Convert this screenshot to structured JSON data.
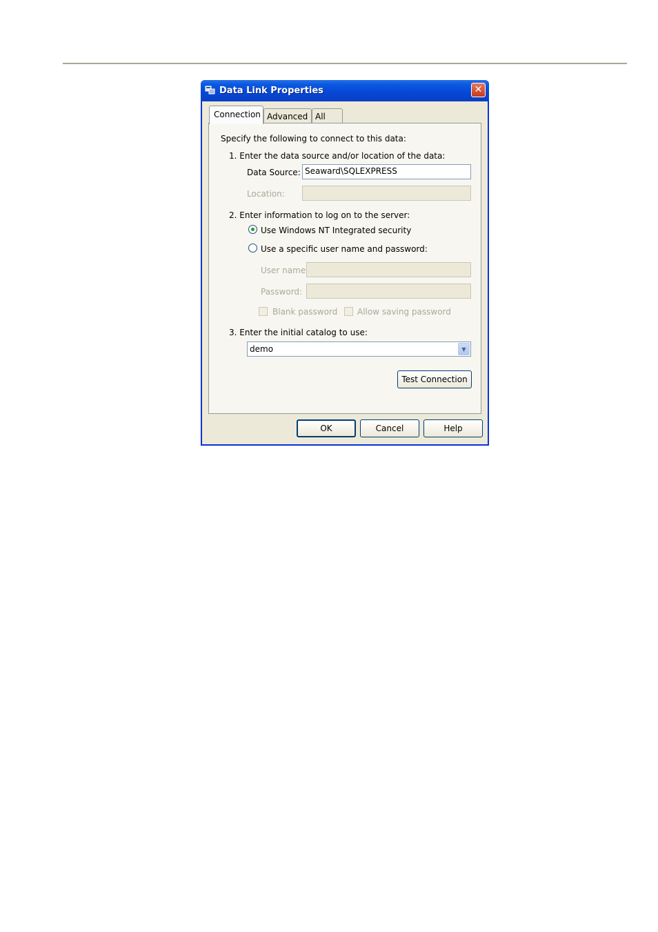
{
  "window": {
    "title": "Data Link Properties",
    "close_glyph": "✕"
  },
  "tabs": [
    {
      "label": "Connection",
      "active": true
    },
    {
      "label": "Advanced"
    },
    {
      "label": "All"
    }
  ],
  "panel": {
    "intro": "Specify the following to connect to this data:",
    "step1": {
      "label": "1. Enter the data source and/or location of the data:",
      "data_source_label": "Data Source:",
      "data_source_value": "Seaward\\SQLEXPRESS",
      "location_label": "Location:",
      "location_value": ""
    },
    "step2": {
      "label": "2. Enter information to log on to the server:",
      "option_nt": "Use Windows NT Integrated security",
      "option_specific": "Use a specific user name and password:",
      "selected": "nt",
      "username_label": "User name:",
      "password_label": "Password:",
      "blank_password": "Blank password",
      "allow_saving": "Allow saving password"
    },
    "step3": {
      "label": "3. Enter the initial catalog to use:",
      "catalog_value": "demo"
    },
    "test_connection": "Test Connection"
  },
  "footer": {
    "ok": "OK",
    "cancel": "Cancel",
    "help": "Help"
  },
  "icons": {
    "title": "data-link-icon",
    "dropdown": "chevron-down-icon",
    "close": "close-icon"
  }
}
